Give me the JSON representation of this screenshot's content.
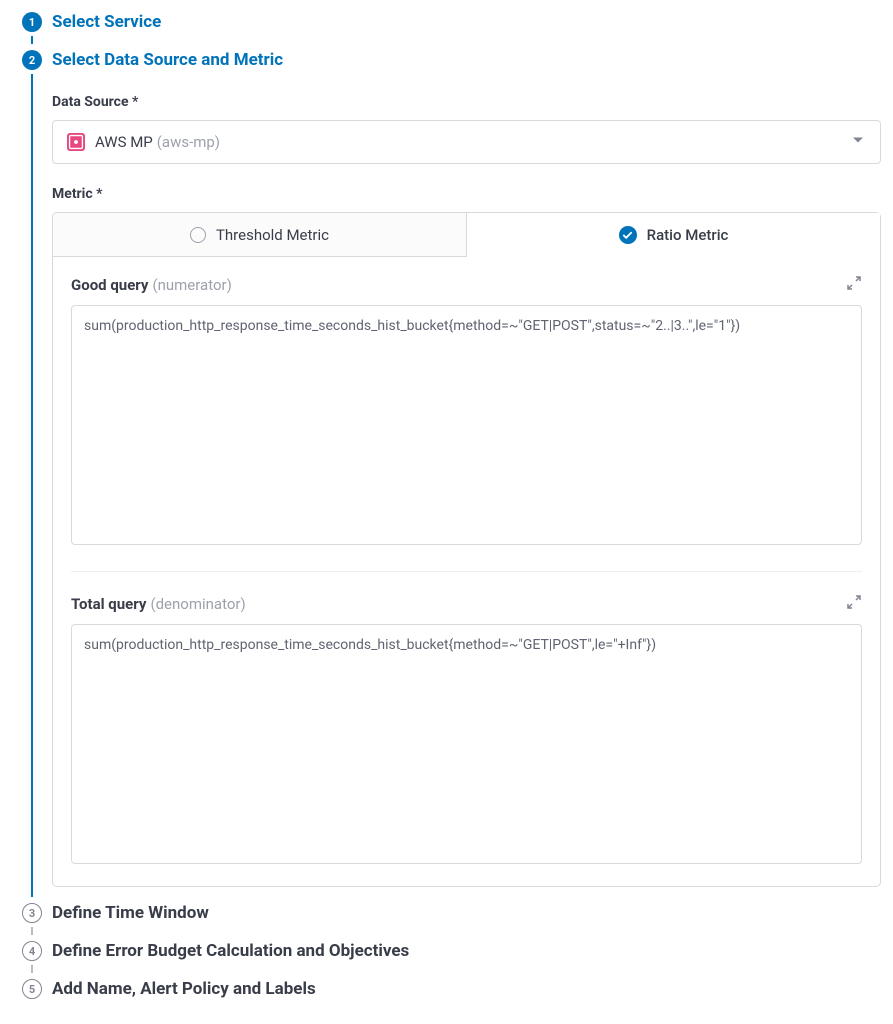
{
  "steps": {
    "s1": {
      "num": "1",
      "title": "Select Service"
    },
    "s2": {
      "num": "2",
      "title": "Select Data Source and Metric"
    },
    "s3": {
      "num": "3",
      "title": "Define Time Window"
    },
    "s4": {
      "num": "4",
      "title": "Define Error Budget Calculation and Objectives"
    },
    "s5": {
      "num": "5",
      "title": "Add Name, Alert Policy and Labels"
    }
  },
  "dataSource": {
    "label": "Data Source *",
    "selectedName": "AWS MP",
    "selectedSub": "(aws-mp)"
  },
  "metric": {
    "label": "Metric *",
    "tabs": {
      "threshold": "Threshold Metric",
      "ratio": "Ratio Metric"
    },
    "goodQuery": {
      "label": "Good query",
      "sub": "(numerator)",
      "value": "sum(production_http_response_time_seconds_hist_bucket{method=~\"GET|POST\",status=~\"2..|3..\",le=\"1\"})"
    },
    "totalQuery": {
      "label": "Total query",
      "sub": "(denominator)",
      "value": "sum(production_http_response_time_seconds_hist_bucket{method=~\"GET|POST\",le=\"+Inf\"})"
    }
  }
}
